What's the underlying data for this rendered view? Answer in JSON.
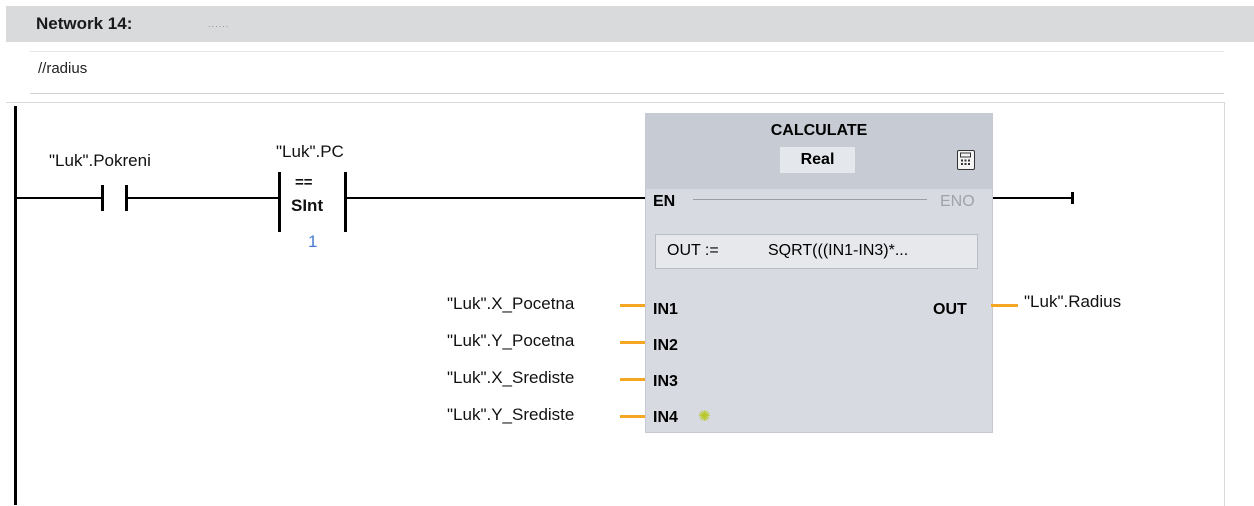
{
  "network": {
    "title": "Network 14:",
    "title_placeholder": "......",
    "comment": "//radius"
  },
  "contacts": {
    "no_contact_operand": "\"Luk\".Pokreni",
    "compare": {
      "operand": "\"Luk\".PC",
      "operator": "==",
      "type": "SInt",
      "value": "1"
    }
  },
  "block": {
    "name": "CALCULATE",
    "data_type": "Real",
    "en": "EN",
    "eno": "ENO",
    "out_assign": "OUT :=",
    "expression": "SQRT(((IN1-IN3)*...",
    "inputs": [
      {
        "pin": "IN1",
        "operand": "\"Luk\".X_Pocetna"
      },
      {
        "pin": "IN2",
        "operand": "\"Luk\".Y_Pocetna"
      },
      {
        "pin": "IN3",
        "operand": "\"Luk\".X_Srediste"
      },
      {
        "pin": "IN4",
        "operand": "\"Luk\".Y_Srediste"
      }
    ],
    "output": {
      "pin": "OUT",
      "operand": "\"Luk\".Radius"
    },
    "icons": [
      "calculator-icon",
      "add-input-star-icon"
    ]
  },
  "colors": {
    "header_bg": "#d9dadc",
    "block_bg": "#d7dae0",
    "block_head_bg": "#c7ccd4",
    "operand_wire": "#f5a623",
    "value_blue": "#4a7bd0",
    "eno_gray": "#a0a4aa"
  }
}
